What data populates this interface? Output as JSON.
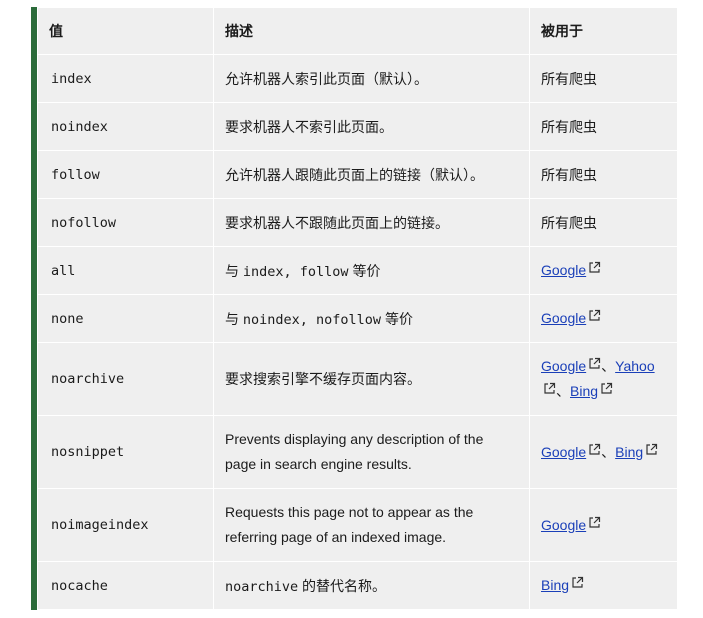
{
  "headers": {
    "value": "值",
    "description": "描述",
    "used_by": "被用于"
  },
  "rows": [
    {
      "value": "index",
      "desc": "允许机器人索引此页面（默认）。",
      "used_by_text": "所有爬虫"
    },
    {
      "value": "noindex",
      "desc": "要求机器人不索引此页面。",
      "used_by_text": "所有爬虫"
    },
    {
      "value": "follow",
      "desc": "允许机器人跟随此页面上的链接（默认）。",
      "used_by_text": "所有爬虫"
    },
    {
      "value": "nofollow",
      "desc": "要求机器人不跟随此页面上的链接。",
      "used_by_text": "所有爬虫"
    },
    {
      "value": "all",
      "desc_pre": "与 ",
      "desc_code": "index, follow",
      "desc_post": " 等价",
      "links": [
        "Google"
      ]
    },
    {
      "value": "none",
      "desc_pre": "与 ",
      "desc_code": "noindex, nofollow",
      "desc_post": " 等价",
      "links": [
        "Google"
      ]
    },
    {
      "value": "noarchive",
      "desc": "要求搜索引擎不缓存页面内容。",
      "links": [
        "Google",
        "Yahoo",
        "Bing"
      ],
      "link_sep": "、"
    },
    {
      "value": "nosnippet",
      "desc": "Prevents displaying any description of the page in search engine results.",
      "links": [
        "Google",
        "Bing"
      ],
      "link_sep": "、"
    },
    {
      "value": "noimageindex",
      "desc": "Requests this page not to appear as the referring page of an indexed image.",
      "links": [
        "Google"
      ]
    },
    {
      "value": "nocache",
      "desc_code": "noarchive",
      "desc_post": " 的替代名称。",
      "links": [
        "Bing"
      ]
    }
  ],
  "icons": {
    "external_link": "external-link-icon"
  },
  "colors": {
    "accent_bar": "#2b6b3a",
    "row_bg": "#efefef",
    "link": "#1a3fb8"
  }
}
